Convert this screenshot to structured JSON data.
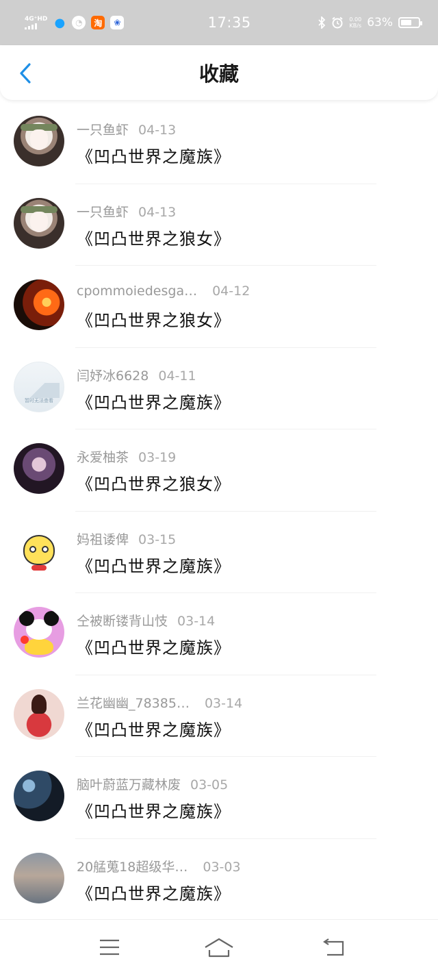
{
  "status_bar": {
    "network": "4G⁺HD",
    "time": "17:35",
    "net_speed_value": "0.00",
    "net_speed_unit": "KB/s",
    "battery_text": "63%",
    "battery_level": 0.63,
    "icons": [
      "qq-icon",
      "speed-test-icon",
      "taobao-icon",
      "baidu-icon",
      "bluetooth-icon",
      "alarm-icon"
    ]
  },
  "header": {
    "title": "收藏",
    "back_icon": "chevron-left-icon",
    "accent_color": "#1e8fe6"
  },
  "items": [
    {
      "user": "一只鱼虾",
      "date": "04-13",
      "title": "《凹凸世界之魔族》",
      "avatar": "anime-white-hair"
    },
    {
      "user": "一只鱼虾",
      "date": "04-13",
      "title": "《凹凸世界之狼女》",
      "avatar": "anime-white-hair"
    },
    {
      "user": "cpommoiedesga…",
      "date": "04-12",
      "title": "《凹凸世界之狼女》",
      "avatar": "fire-warrior"
    },
    {
      "user": "闫妤冰6628",
      "date": "04-11",
      "title": "《凹凸世界之魔族》",
      "avatar": "placeholder",
      "avatar_caption": "暂时无法查看"
    },
    {
      "user": "永爱柚茶",
      "date": "03-19",
      "title": "《凹凸世界之狼女》",
      "avatar": "gothic-girl"
    },
    {
      "user": "妈祖诿俾",
      "date": "03-15",
      "title": "《凹凸世界之魔族》",
      "avatar": "cartoon-yellow"
    },
    {
      "user": "仝被断镂背山忮",
      "date": "03-14",
      "title": "《凹凸世界之魔族》",
      "avatar": "cartoon-pink"
    },
    {
      "user": "兰花幽幽_78385…",
      "date": "03-14",
      "title": "《凹凸世界之魔族》",
      "avatar": "red-dress"
    },
    {
      "user": "脑叶蔚蓝万藏林废",
      "date": "03-05",
      "title": "《凹凸世界之魔族》",
      "avatar": "dark-blue-scene"
    },
    {
      "user": "20艋蒐18超级华…",
      "date": "03-03",
      "title": "《凹凸世界之魔族》",
      "avatar": "dusk-landscape"
    }
  ],
  "nav": {
    "icons": [
      "menu-icon",
      "home-icon",
      "back-icon"
    ]
  }
}
